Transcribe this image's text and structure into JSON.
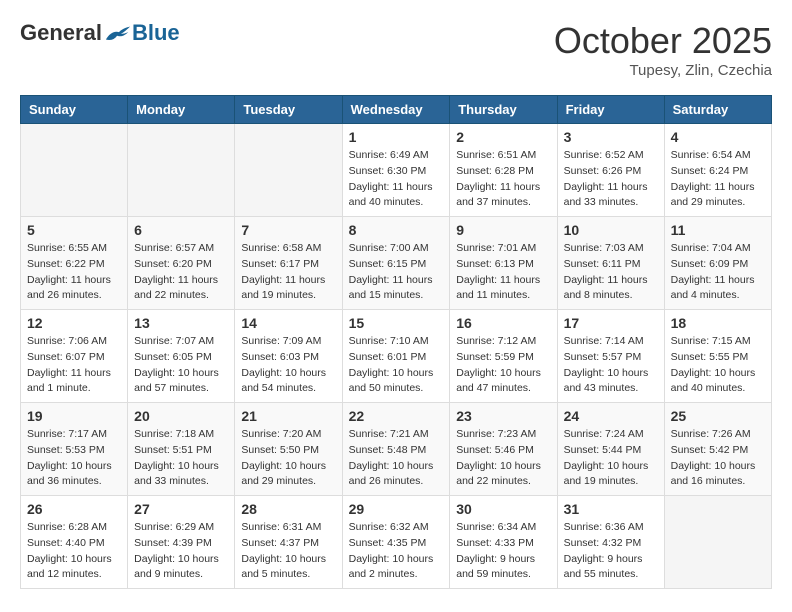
{
  "header": {
    "logo_general": "General",
    "logo_blue": "Blue",
    "month_title": "October 2025",
    "location": "Tupesy, Zlin, Czechia"
  },
  "days_of_week": [
    "Sunday",
    "Monday",
    "Tuesday",
    "Wednesday",
    "Thursday",
    "Friday",
    "Saturday"
  ],
  "weeks": [
    [
      {
        "day": "",
        "info": ""
      },
      {
        "day": "",
        "info": ""
      },
      {
        "day": "",
        "info": ""
      },
      {
        "day": "1",
        "info": "Sunrise: 6:49 AM\nSunset: 6:30 PM\nDaylight: 11 hours\nand 40 minutes."
      },
      {
        "day": "2",
        "info": "Sunrise: 6:51 AM\nSunset: 6:28 PM\nDaylight: 11 hours\nand 37 minutes."
      },
      {
        "day": "3",
        "info": "Sunrise: 6:52 AM\nSunset: 6:26 PM\nDaylight: 11 hours\nand 33 minutes."
      },
      {
        "day": "4",
        "info": "Sunrise: 6:54 AM\nSunset: 6:24 PM\nDaylight: 11 hours\nand 29 minutes."
      }
    ],
    [
      {
        "day": "5",
        "info": "Sunrise: 6:55 AM\nSunset: 6:22 PM\nDaylight: 11 hours\nand 26 minutes."
      },
      {
        "day": "6",
        "info": "Sunrise: 6:57 AM\nSunset: 6:20 PM\nDaylight: 11 hours\nand 22 minutes."
      },
      {
        "day": "7",
        "info": "Sunrise: 6:58 AM\nSunset: 6:17 PM\nDaylight: 11 hours\nand 19 minutes."
      },
      {
        "day": "8",
        "info": "Sunrise: 7:00 AM\nSunset: 6:15 PM\nDaylight: 11 hours\nand 15 minutes."
      },
      {
        "day": "9",
        "info": "Sunrise: 7:01 AM\nSunset: 6:13 PM\nDaylight: 11 hours\nand 11 minutes."
      },
      {
        "day": "10",
        "info": "Sunrise: 7:03 AM\nSunset: 6:11 PM\nDaylight: 11 hours\nand 8 minutes."
      },
      {
        "day": "11",
        "info": "Sunrise: 7:04 AM\nSunset: 6:09 PM\nDaylight: 11 hours\nand 4 minutes."
      }
    ],
    [
      {
        "day": "12",
        "info": "Sunrise: 7:06 AM\nSunset: 6:07 PM\nDaylight: 11 hours\nand 1 minute."
      },
      {
        "day": "13",
        "info": "Sunrise: 7:07 AM\nSunset: 6:05 PM\nDaylight: 10 hours\nand 57 minutes."
      },
      {
        "day": "14",
        "info": "Sunrise: 7:09 AM\nSunset: 6:03 PM\nDaylight: 10 hours\nand 54 minutes."
      },
      {
        "day": "15",
        "info": "Sunrise: 7:10 AM\nSunset: 6:01 PM\nDaylight: 10 hours\nand 50 minutes."
      },
      {
        "day": "16",
        "info": "Sunrise: 7:12 AM\nSunset: 5:59 PM\nDaylight: 10 hours\nand 47 minutes."
      },
      {
        "day": "17",
        "info": "Sunrise: 7:14 AM\nSunset: 5:57 PM\nDaylight: 10 hours\nand 43 minutes."
      },
      {
        "day": "18",
        "info": "Sunrise: 7:15 AM\nSunset: 5:55 PM\nDaylight: 10 hours\nand 40 minutes."
      }
    ],
    [
      {
        "day": "19",
        "info": "Sunrise: 7:17 AM\nSunset: 5:53 PM\nDaylight: 10 hours\nand 36 minutes."
      },
      {
        "day": "20",
        "info": "Sunrise: 7:18 AM\nSunset: 5:51 PM\nDaylight: 10 hours\nand 33 minutes."
      },
      {
        "day": "21",
        "info": "Sunrise: 7:20 AM\nSunset: 5:50 PM\nDaylight: 10 hours\nand 29 minutes."
      },
      {
        "day": "22",
        "info": "Sunrise: 7:21 AM\nSunset: 5:48 PM\nDaylight: 10 hours\nand 26 minutes."
      },
      {
        "day": "23",
        "info": "Sunrise: 7:23 AM\nSunset: 5:46 PM\nDaylight: 10 hours\nand 22 minutes."
      },
      {
        "day": "24",
        "info": "Sunrise: 7:24 AM\nSunset: 5:44 PM\nDaylight: 10 hours\nand 19 minutes."
      },
      {
        "day": "25",
        "info": "Sunrise: 7:26 AM\nSunset: 5:42 PM\nDaylight: 10 hours\nand 16 minutes."
      }
    ],
    [
      {
        "day": "26",
        "info": "Sunrise: 6:28 AM\nSunset: 4:40 PM\nDaylight: 10 hours\nand 12 minutes."
      },
      {
        "day": "27",
        "info": "Sunrise: 6:29 AM\nSunset: 4:39 PM\nDaylight: 10 hours\nand 9 minutes."
      },
      {
        "day": "28",
        "info": "Sunrise: 6:31 AM\nSunset: 4:37 PM\nDaylight: 10 hours\nand 5 minutes."
      },
      {
        "day": "29",
        "info": "Sunrise: 6:32 AM\nSunset: 4:35 PM\nDaylight: 10 hours\nand 2 minutes."
      },
      {
        "day": "30",
        "info": "Sunrise: 6:34 AM\nSunset: 4:33 PM\nDaylight: 9 hours\nand 59 minutes."
      },
      {
        "day": "31",
        "info": "Sunrise: 6:36 AM\nSunset: 4:32 PM\nDaylight: 9 hours\nand 55 minutes."
      },
      {
        "day": "",
        "info": ""
      }
    ]
  ]
}
